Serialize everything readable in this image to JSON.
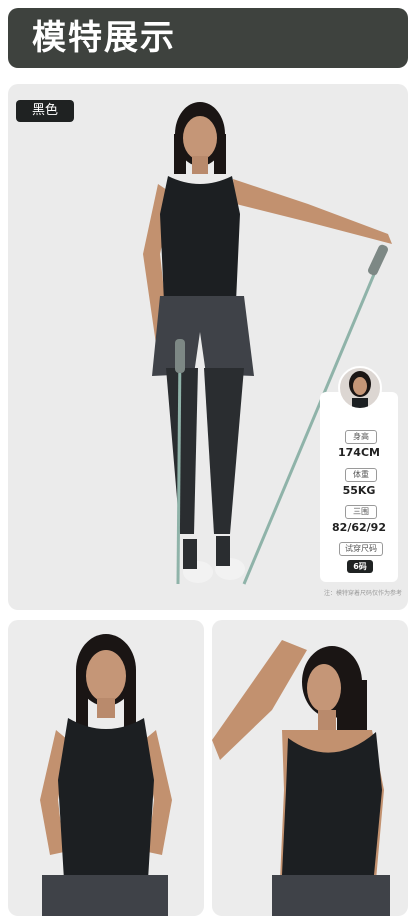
{
  "header": {
    "title": "模特展示"
  },
  "color_tag": "黑色",
  "model_card": {
    "height_label": "身高",
    "height_value": "174CM",
    "weight_label": "体重",
    "weight_value": "55KG",
    "measure_label": "三围",
    "measure_value": "82/62/92",
    "size_label": "试穿尺码",
    "size_value": "6码"
  },
  "footnote": "注：模特穿着尺码仅作为参考",
  "colors": {
    "header_bg": "#3e423e",
    "panel_bg": "#ebebeb",
    "garment": "#1c1f22",
    "band": "#8fb3a9"
  }
}
